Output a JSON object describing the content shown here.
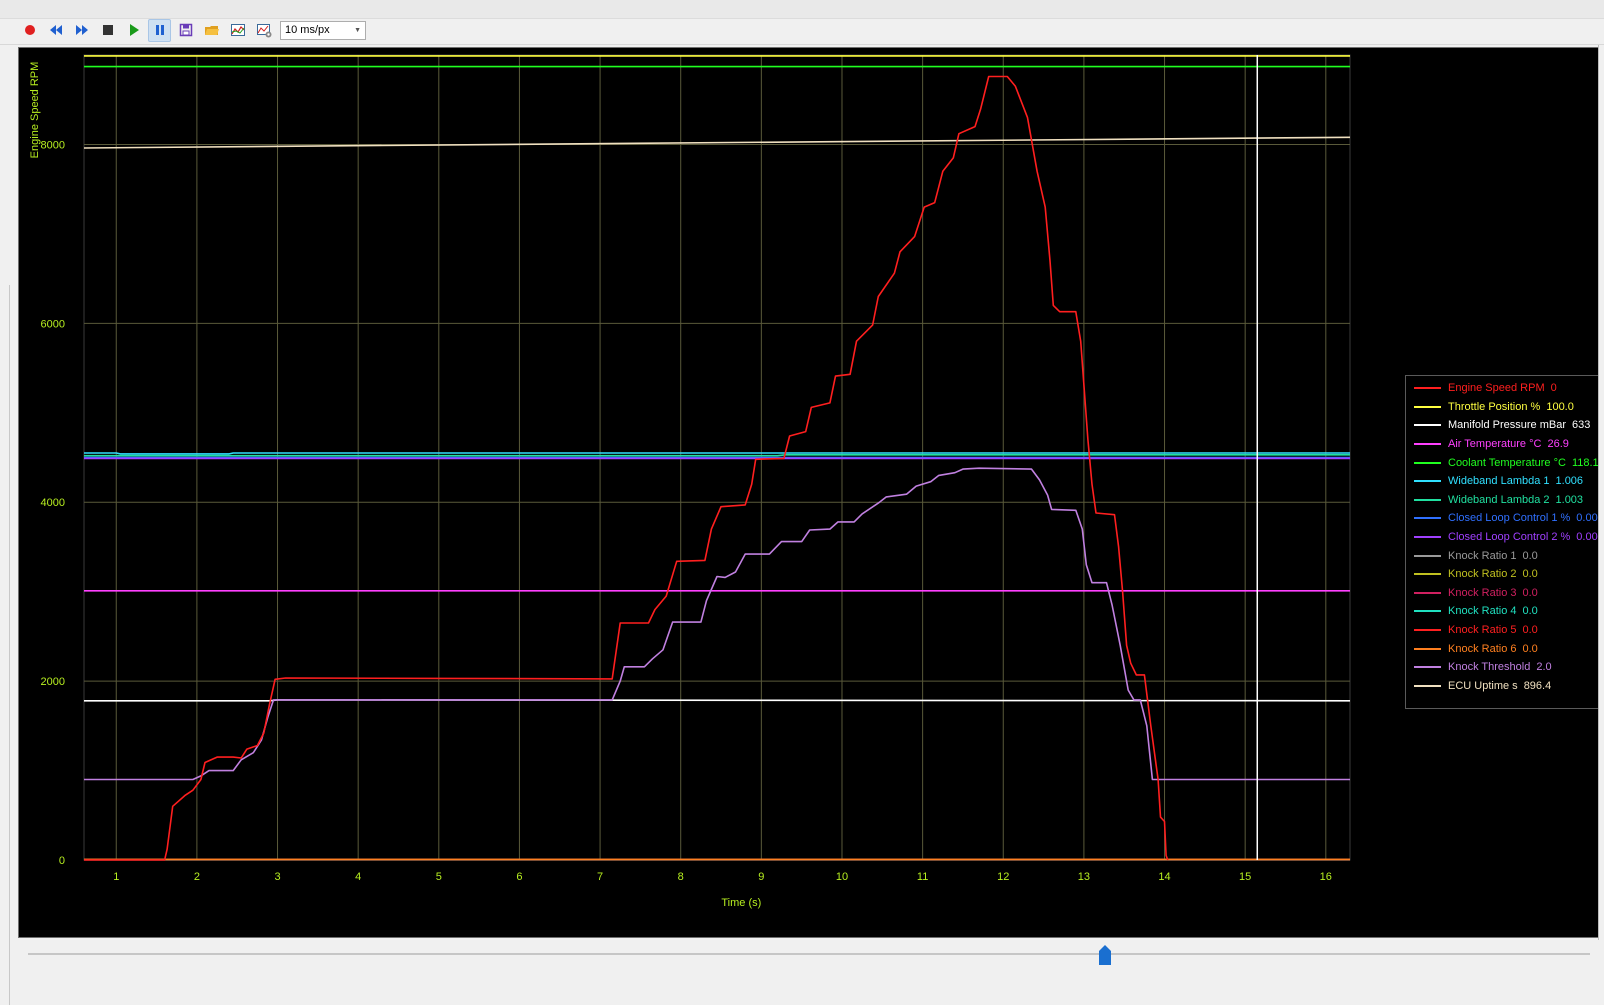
{
  "toolbar": {
    "buttons": [
      {
        "name": "record-icon",
        "color": "#e02020"
      },
      {
        "name": "rewind-icon",
        "color": "#2060d0"
      },
      {
        "name": "fast-forward-icon",
        "color": "#2060d0"
      },
      {
        "name": "stop-icon",
        "color": "#333333"
      },
      {
        "name": "play-icon",
        "color": "#1a9a1a"
      },
      {
        "name": "pause-icon",
        "color": "#2060d0",
        "active": true
      },
      {
        "name": "save-icon",
        "color": "#6a3cb8"
      },
      {
        "name": "open-folder-icon",
        "color": "#e0a020"
      },
      {
        "name": "graph-settings-icon",
        "color": "#3a6a9a"
      },
      {
        "name": "graph-config-icon",
        "color": "#3a6a9a"
      }
    ],
    "zoom_select": {
      "value": "10 ms/px"
    }
  },
  "chart_data": {
    "type": "line",
    "xlabel": "Time (s)",
    "ylabel": "Engine Speed RPM",
    "xlim": [
      0.6,
      16.3
    ],
    "ylim": [
      0,
      9000
    ],
    "x_ticks": [
      "1",
      "2",
      "3",
      "4",
      "5",
      "6",
      "7",
      "8",
      "9",
      "10",
      "11",
      "12",
      "13",
      "14",
      "15",
      "16"
    ],
    "y_ticks": [
      "0",
      "2000",
      "4000",
      "6000",
      "8000"
    ],
    "grid": true,
    "legend_position": "right",
    "cursor_x": 15.15,
    "series": [
      {
        "name": "Engine Speed RPM",
        "value": "0",
        "color": "#ff1f1f",
        "points": [
          [
            0.6,
            0
          ],
          [
            1.6,
            0
          ],
          [
            1.63,
            120
          ],
          [
            1.7,
            600
          ],
          [
            1.85,
            720
          ],
          [
            1.95,
            780
          ],
          [
            2.05,
            900
          ],
          [
            2.1,
            1090
          ],
          [
            2.25,
            1150
          ],
          [
            2.45,
            1150
          ],
          [
            2.55,
            1140
          ],
          [
            2.62,
            1240
          ],
          [
            2.75,
            1280
          ],
          [
            2.83,
            1420
          ],
          [
            2.9,
            1740
          ],
          [
            2.97,
            2020
          ],
          [
            3.1,
            2035
          ],
          [
            5,
            2030
          ],
          [
            7.15,
            2025
          ],
          [
            7.25,
            2650
          ],
          [
            7.6,
            2650
          ],
          [
            7.68,
            2800
          ],
          [
            7.82,
            2950
          ],
          [
            7.95,
            3340
          ],
          [
            8.3,
            3350
          ],
          [
            8.38,
            3700
          ],
          [
            8.5,
            3950
          ],
          [
            8.8,
            3970
          ],
          [
            8.88,
            4200
          ],
          [
            8.93,
            4480
          ],
          [
            9.28,
            4490
          ],
          [
            9.35,
            4740
          ],
          [
            9.55,
            4790
          ],
          [
            9.62,
            5060
          ],
          [
            9.85,
            5110
          ],
          [
            9.92,
            5410
          ],
          [
            10.1,
            5430
          ],
          [
            10.18,
            5800
          ],
          [
            10.38,
            5980
          ],
          [
            10.45,
            6300
          ],
          [
            10.65,
            6560
          ],
          [
            10.72,
            6800
          ],
          [
            10.9,
            6970
          ],
          [
            11.02,
            7300
          ],
          [
            11.15,
            7350
          ],
          [
            11.25,
            7700
          ],
          [
            11.38,
            7850
          ],
          [
            11.45,
            8120
          ],
          [
            11.65,
            8200
          ],
          [
            11.72,
            8400
          ],
          [
            11.82,
            8760
          ],
          [
            12.05,
            8760
          ],
          [
            12.15,
            8650
          ],
          [
            12.3,
            8300
          ],
          [
            12.42,
            7700
          ],
          [
            12.52,
            7300
          ],
          [
            12.58,
            6700
          ],
          [
            12.62,
            6200
          ],
          [
            12.7,
            6130
          ],
          [
            12.9,
            6130
          ],
          [
            12.96,
            5800
          ],
          [
            13.05,
            4700
          ],
          [
            13.1,
            4200
          ],
          [
            13.15,
            3880
          ],
          [
            13.38,
            3860
          ],
          [
            13.43,
            3500
          ],
          [
            13.48,
            3000
          ],
          [
            13.53,
            2400
          ],
          [
            13.58,
            2200
          ],
          [
            13.65,
            2070
          ],
          [
            13.75,
            2070
          ],
          [
            13.83,
            1500
          ],
          [
            13.92,
            900
          ],
          [
            13.95,
            480
          ],
          [
            14.0,
            430
          ],
          [
            14.02,
            50
          ],
          [
            14.04,
            0
          ]
        ]
      },
      {
        "name": "Throttle Position %",
        "value": "100.0",
        "color": "#ffff40",
        "points": [
          [
            0.6,
            8990
          ],
          [
            16.3,
            8990
          ]
        ]
      },
      {
        "name": "Manifold Pressure mBar",
        "value": "633",
        "color": "#ffffff",
        "points": [
          [
            0.6,
            1780
          ],
          [
            2.9,
            1780
          ],
          [
            3,
            1790
          ],
          [
            16.3,
            1780
          ]
        ]
      },
      {
        "name": "Air Temperature °C",
        "value": "26.9",
        "color": "#ff40ff",
        "points": [
          [
            0.6,
            3010
          ],
          [
            16.3,
            3010
          ]
        ]
      },
      {
        "name": "Coolant Temperature °C",
        "value": "118.1",
        "color": "#20ff20",
        "points": [
          [
            0.6,
            8870
          ],
          [
            16.3,
            8870
          ]
        ]
      },
      {
        "name": "Wideband Lambda 1",
        "value": "1.006",
        "color": "#30e0ff",
        "points": [
          [
            0.6,
            4550
          ],
          [
            1.0,
            4550
          ],
          [
            1.05,
            4540
          ],
          [
            2.4,
            4540
          ],
          [
            2.45,
            4550
          ],
          [
            16.3,
            4550
          ]
        ]
      },
      {
        "name": "Wideband Lambda 2",
        "value": "1.003",
        "color": "#20e0a0",
        "points": [
          [
            0.6,
            4520
          ],
          [
            9.2,
            4520
          ],
          [
            9.3,
            4530
          ],
          [
            16.3,
            4530
          ]
        ]
      },
      {
        "name": "Closed Loop Control 1 %",
        "value": "0.00",
        "color": "#3070ff",
        "points": [
          [
            0.6,
            4500
          ],
          [
            16.3,
            4500
          ]
        ]
      },
      {
        "name": "Closed Loop Control 2 %",
        "value": "0.00",
        "color": "#a040ff",
        "points": [
          [
            0.6,
            4490
          ],
          [
            16.3,
            4490
          ]
        ]
      },
      {
        "name": "Knock Ratio 1",
        "value": "0.0",
        "color": "#9a9a9a",
        "points": [
          [
            0.6,
            2
          ],
          [
            16.3,
            2
          ]
        ]
      },
      {
        "name": "Knock Ratio 2",
        "value": "0.0",
        "color": "#c0c020",
        "points": [
          [
            0.6,
            3
          ],
          [
            16.3,
            3
          ]
        ]
      },
      {
        "name": "Knock Ratio 3",
        "value": "0.0",
        "color": "#d02060",
        "points": [
          [
            0.6,
            4
          ],
          [
            16.3,
            4
          ]
        ]
      },
      {
        "name": "Knock Ratio 4",
        "value": "0.0",
        "color": "#20e0c0",
        "points": [
          [
            0.6,
            5
          ],
          [
            16.3,
            5
          ]
        ]
      },
      {
        "name": "Knock Ratio 5",
        "value": "0.0",
        "color": "#ff2020",
        "points": [
          [
            0.6,
            6
          ],
          [
            16.3,
            6
          ]
        ]
      },
      {
        "name": "Knock Ratio 6",
        "value": "0.0",
        "color": "#ff8020",
        "points": [
          [
            0.6,
            7
          ],
          [
            16.3,
            7
          ]
        ]
      },
      {
        "name": "Knock Threshold",
        "value": "2.0",
        "color": "#c080e0",
        "points": [
          [
            0.6,
            900
          ],
          [
            1.95,
            900
          ],
          [
            2.05,
            940
          ],
          [
            2.15,
            1000
          ],
          [
            2.45,
            1000
          ],
          [
            2.55,
            1120
          ],
          [
            2.7,
            1200
          ],
          [
            2.8,
            1340
          ],
          [
            2.88,
            1600
          ],
          [
            2.95,
            1790
          ],
          [
            7.15,
            1790
          ],
          [
            7.25,
            2000
          ],
          [
            7.3,
            2160
          ],
          [
            7.55,
            2160
          ],
          [
            7.65,
            2250
          ],
          [
            7.78,
            2350
          ],
          [
            7.9,
            2660
          ],
          [
            8.25,
            2660
          ],
          [
            8.32,
            2900
          ],
          [
            8.45,
            3170
          ],
          [
            8.55,
            3160
          ],
          [
            8.68,
            3220
          ],
          [
            8.8,
            3420
          ],
          [
            9.1,
            3420
          ],
          [
            9.25,
            3560
          ],
          [
            9.5,
            3560
          ],
          [
            9.6,
            3690
          ],
          [
            9.85,
            3700
          ],
          [
            9.95,
            3780
          ],
          [
            10.15,
            3780
          ],
          [
            10.25,
            3870
          ],
          [
            10.45,
            3990
          ],
          [
            10.55,
            4060
          ],
          [
            10.8,
            4090
          ],
          [
            10.92,
            4180
          ],
          [
            11.1,
            4230
          ],
          [
            11.2,
            4300
          ],
          [
            11.4,
            4330
          ],
          [
            11.5,
            4370
          ],
          [
            11.7,
            4380
          ],
          [
            12.35,
            4370
          ],
          [
            12.45,
            4250
          ],
          [
            12.55,
            4080
          ],
          [
            12.6,
            3920
          ],
          [
            12.9,
            3910
          ],
          [
            12.98,
            3700
          ],
          [
            13.03,
            3300
          ],
          [
            13.1,
            3100
          ],
          [
            13.28,
            3100
          ],
          [
            13.35,
            2850
          ],
          [
            13.45,
            2400
          ],
          [
            13.55,
            1900
          ],
          [
            13.62,
            1790
          ],
          [
            13.7,
            1790
          ],
          [
            13.78,
            1500
          ],
          [
            13.85,
            900
          ],
          [
            16.3,
            900
          ]
        ]
      },
      {
        "name": "ECU Uptime s",
        "value": "896.4",
        "color": "#f0e0c0",
        "points": [
          [
            0.6,
            7960
          ],
          [
            16.3,
            8080
          ]
        ]
      }
    ]
  }
}
